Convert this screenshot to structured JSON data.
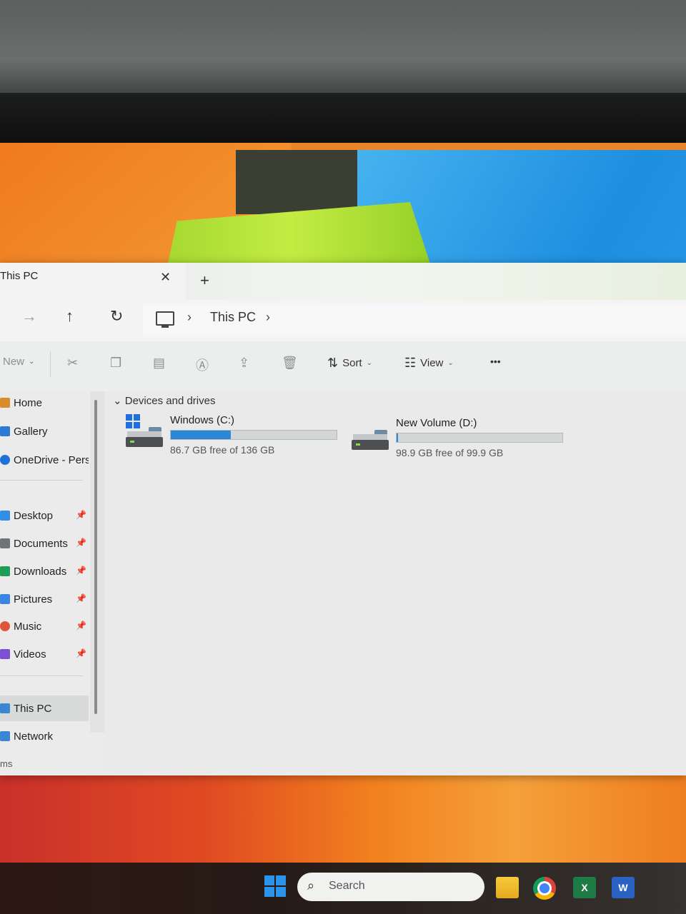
{
  "window": {
    "tab_title": "This PC",
    "tab_close_glyph": "✕",
    "new_tab_glyph": "+"
  },
  "nav": {
    "forward_glyph": "→",
    "up_glyph": "↑",
    "refresh_glyph": "↻",
    "crumb_sep": "›",
    "breadcrumb": "This PC"
  },
  "toolbar": {
    "new_label": "New",
    "sort_label": "Sort",
    "view_label": "View",
    "more_glyph": "•••",
    "icons": [
      "cut-icon",
      "copy-icon",
      "paste-icon",
      "rename-icon",
      "share-icon",
      "delete-icon"
    ]
  },
  "sidebar": {
    "top_items": [
      {
        "label": "Home",
        "icon": "home-icon",
        "color": "#d98c2b"
      },
      {
        "label": "Gallery",
        "icon": "gallery-icon",
        "color": "#2a7bd6"
      },
      {
        "label": "OneDrive - Perso",
        "icon": "onedrive-icon",
        "color": "#1e73d8"
      }
    ],
    "quick_access": [
      {
        "label": "Desktop",
        "icon": "desktop-icon",
        "color": "#2f8fe6"
      },
      {
        "label": "Documents",
        "icon": "documents-icon",
        "color": "#6f7478"
      },
      {
        "label": "Downloads",
        "icon": "downloads-icon",
        "color": "#1f9d55"
      },
      {
        "label": "Pictures",
        "icon": "pictures-icon",
        "color": "#3a86e0"
      },
      {
        "label": "Music",
        "icon": "music-icon",
        "color": "#e0553a"
      },
      {
        "label": "Videos",
        "icon": "videos-icon",
        "color": "#7b4fd6"
      }
    ],
    "bottom_items": [
      {
        "label": "This PC",
        "icon": "this-pc-icon",
        "color": "#3a86d0"
      },
      {
        "label": "Network",
        "icon": "network-icon",
        "color": "#3a86d0"
      }
    ],
    "footer_text": "ms"
  },
  "content": {
    "group_label": "Devices and drives",
    "group_chevron": "⌄",
    "drives": [
      {
        "name": "Windows (C:)",
        "free_text": "86.7 GB free of 136 GB",
        "used_fraction": 0.36
      },
      {
        "name": "New Volume (D:)",
        "free_text": "98.9 GB free of 99.9 GB",
        "used_fraction": 0.01
      }
    ]
  },
  "taskbar": {
    "search_placeholder": "Search",
    "excel_glyph": "X",
    "word_glyph": "W"
  },
  "colors": {
    "accent": "#2a88d6"
  }
}
